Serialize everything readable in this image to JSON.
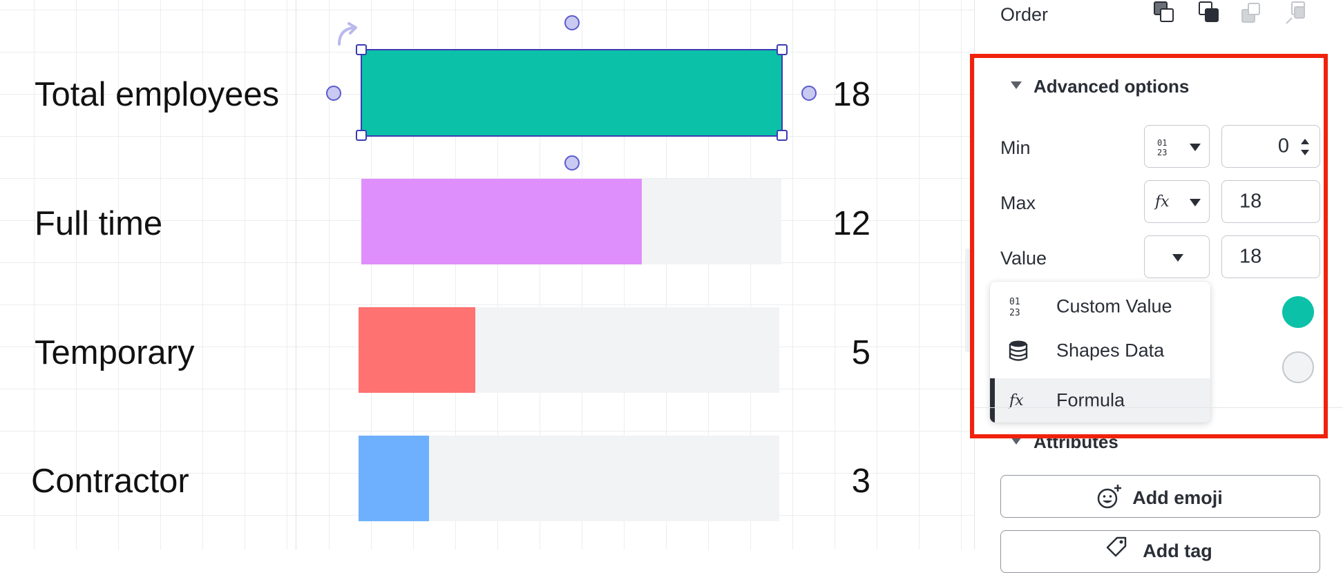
{
  "canvas": {
    "rows": [
      {
        "label": "Total employees",
        "value": "18",
        "fill_fraction": 1.0,
        "color": "#0bc2a8"
      },
      {
        "label": "Full time",
        "value": "12",
        "fill_fraction": 0.667,
        "color": "#df8ffb"
      },
      {
        "label": "Temporary",
        "value": "5",
        "fill_fraction": 0.278,
        "color": "#fe7271"
      },
      {
        "label": "Contractor",
        "value": "3",
        "fill_fraction": 0.167,
        "color": "#6eb0fd"
      }
    ],
    "track_color": "#f2f3f4",
    "selection_color": "#3b3bb3"
  },
  "panel": {
    "order_label": "Order",
    "order_icons": [
      "bring-to-front-icon",
      "bring-forward-icon",
      "send-backward-icon",
      "send-to-back-icon"
    ],
    "advanced": {
      "title": "Advanced options",
      "min": {
        "label": "Min",
        "source_icon": "custom-value-icon",
        "value": "0"
      },
      "max": {
        "label": "Max",
        "source_icon": "formula-icon",
        "value": "18"
      },
      "value": {
        "label": "Value",
        "value": "18"
      },
      "swatch_colors": [
        "#0bc2a8",
        "#f2f3f4"
      ]
    },
    "source_menu": {
      "items": [
        {
          "label": "Custom Value",
          "icon": "custom-value-icon"
        },
        {
          "label": "Shapes Data",
          "icon": "database-icon"
        },
        {
          "label": "Formula",
          "icon": "formula-icon"
        }
      ],
      "selected": "Formula"
    },
    "attributes": {
      "title": "Attributes",
      "add_emoji_label": "Add emoji",
      "add_tag_label": "Add tag"
    }
  },
  "highlight_color": "#f0220c"
}
